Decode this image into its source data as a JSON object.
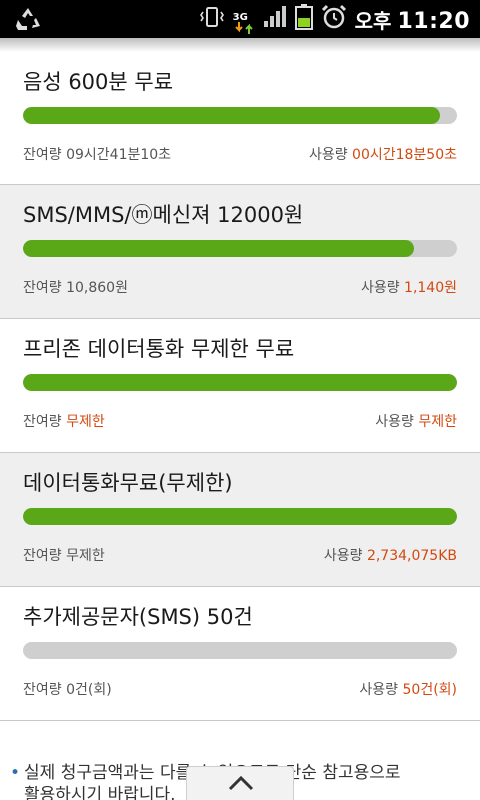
{
  "status_bar": {
    "network_label": "3G",
    "ampm": "오후",
    "time": "11:20",
    "icons": [
      "recycle-icon",
      "vibrate-icon",
      "network-3g-icon",
      "signal-icon",
      "battery-icon",
      "alarm-icon"
    ]
  },
  "colors": {
    "bar_fill": "#5aa818",
    "bar_track": "#cfcfcf",
    "accent_value": "#d24a10",
    "alt_row": "#efefef"
  },
  "plans": [
    {
      "title": "음성 600분 무료",
      "fill_fraction": 0.96,
      "remaining_label": "잔여량",
      "remaining_value": "09시간41분10초",
      "remaining_highlight": false,
      "used_label": "사용량",
      "used_value": "00시간18분50초"
    },
    {
      "title": "SMS/MMS/ⓜ메신져 12000원",
      "fill_fraction": 0.9,
      "remaining_label": "잔여량",
      "remaining_value": "10,860원",
      "remaining_highlight": false,
      "used_label": "사용량",
      "used_value": "1,140원"
    },
    {
      "title": "프리존 데이터통화 무제한 무료",
      "fill_fraction": 1.0,
      "remaining_label": "잔여량",
      "remaining_value": "무제한",
      "remaining_highlight": true,
      "used_label": "사용량",
      "used_value": "무제한"
    },
    {
      "title": "데이터통화무료(무제한)",
      "fill_fraction": 1.0,
      "remaining_label": "잔여량",
      "remaining_value": "무제한",
      "remaining_highlight": false,
      "used_label": "사용량",
      "used_value": "2,734,075KB"
    },
    {
      "title": "추가제공문자(SMS) 50건",
      "fill_fraction": 0.0,
      "remaining_label": "잔여량",
      "remaining_value": "0건(회)",
      "remaining_highlight": false,
      "used_label": "사용량",
      "used_value": "50건(회)"
    }
  ],
  "footer_note": {
    "line1": "실제 청구금액과는 다를 수 있으므로 단순 참고용으로",
    "line2": "활용하시기 바랍니다."
  },
  "scroll_top_icon": "chevron-up-icon"
}
